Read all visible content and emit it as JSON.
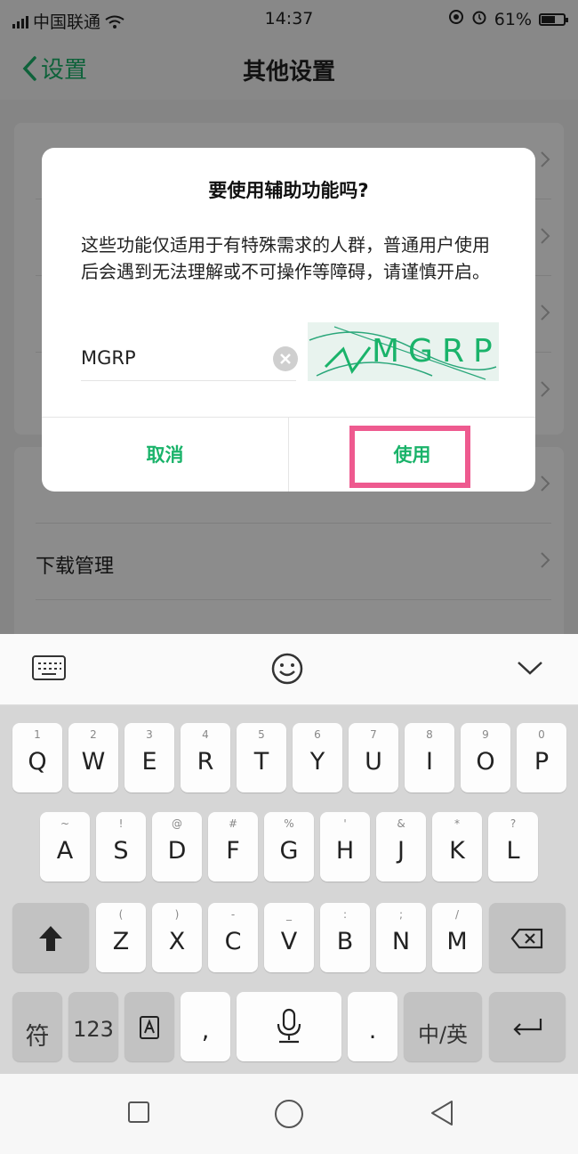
{
  "status_bar": {
    "carrier": "中国联通",
    "time": "14:37",
    "battery": "61%"
  },
  "header": {
    "back_label": "设置",
    "title": "其他设置"
  },
  "list": {
    "row_download": "下载管理"
  },
  "dialog": {
    "title": "要使用辅助功能吗?",
    "message": "这些功能仅适用于有特殊需求的人群，普通用户使用后会遇到无法理解或不可操作等障碍，请谨慎开启。",
    "captcha_input_value": "MGRP",
    "captcha_image_text": "MGRP",
    "cancel_label": "取消",
    "confirm_label": "使用"
  },
  "keyboard": {
    "row1": [
      {
        "sub": "1",
        "main": "Q"
      },
      {
        "sub": "2",
        "main": "W"
      },
      {
        "sub": "3",
        "main": "E"
      },
      {
        "sub": "4",
        "main": "R"
      },
      {
        "sub": "5",
        "main": "T"
      },
      {
        "sub": "6",
        "main": "Y"
      },
      {
        "sub": "7",
        "main": "U"
      },
      {
        "sub": "8",
        "main": "I"
      },
      {
        "sub": "9",
        "main": "O"
      },
      {
        "sub": "0",
        "main": "P"
      }
    ],
    "row2": [
      {
        "sub": "~",
        "main": "A"
      },
      {
        "sub": "!",
        "main": "S"
      },
      {
        "sub": "@",
        "main": "D"
      },
      {
        "sub": "#",
        "main": "F"
      },
      {
        "sub": "%",
        "main": "G"
      },
      {
        "sub": "'",
        "main": "H"
      },
      {
        "sub": "&",
        "main": "J"
      },
      {
        "sub": "*",
        "main": "K"
      },
      {
        "sub": "?",
        "main": "L"
      }
    ],
    "row3": [
      {
        "sub": "(",
        "main": "Z"
      },
      {
        "sub": ")",
        "main": "X"
      },
      {
        "sub": "-",
        "main": "C"
      },
      {
        "sub": "_",
        "main": "V"
      },
      {
        "sub": ":",
        "main": "B"
      },
      {
        "sub": ";",
        "main": "N"
      },
      {
        "sub": "/",
        "main": "M"
      }
    ],
    "symbol_key": "符",
    "number_key": "123",
    "comma_key": ",",
    "period_key": ".",
    "lang_key": "中/英"
  },
  "colors": {
    "accent": "#1ab36a",
    "highlight": "#ee5a8f"
  }
}
